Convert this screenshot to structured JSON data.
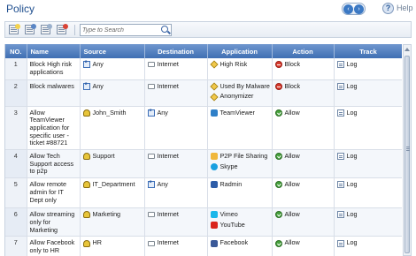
{
  "header": {
    "title": "Policy",
    "help_label": "Help"
  },
  "toolbar": {
    "icons": [
      "new-rule-icon",
      "edit-rule-icon",
      "copy-rule-icon",
      "delete-rule-icon"
    ],
    "search_placeholder": "Type to Search"
  },
  "table": {
    "columns": {
      "no": "NO.",
      "name": "Name",
      "source": "Source",
      "destination": "Destination",
      "application": "Application",
      "action": "Action",
      "track": "Track"
    },
    "rows": [
      {
        "no": "1",
        "name": "Block High risk applications",
        "source": {
          "label": "Any",
          "icon": "any-icon"
        },
        "destination": {
          "label": "Internet",
          "icon": "internet-icon"
        },
        "applications": [
          {
            "label": "High Risk",
            "icon": "tag-icon"
          }
        ],
        "action": {
          "label": "Block",
          "icon": "block-icon"
        },
        "track": "Log"
      },
      {
        "no": "2",
        "name": "Block malwares",
        "source": {
          "label": "Any",
          "icon": "any-icon"
        },
        "destination": {
          "label": "Internet",
          "icon": "internet-icon"
        },
        "applications": [
          {
            "label": "Used By Malware",
            "icon": "tag-icon"
          },
          {
            "label": "Anonymizer",
            "icon": "tag-icon"
          }
        ],
        "action": {
          "label": "Block",
          "icon": "block-icon"
        },
        "track": "Log"
      },
      {
        "no": "3",
        "name": "Allow TeamViewer application for specific user - ticket #88721",
        "source": {
          "label": "John_Smith",
          "icon": "user-icon"
        },
        "destination": {
          "label": "Any",
          "icon": "any-icon"
        },
        "applications": [
          {
            "label": "TeamViewer",
            "icon": "teamviewer-icon"
          }
        ],
        "action": {
          "label": "Allow",
          "icon": "allow-icon"
        },
        "track": "Log"
      },
      {
        "no": "4",
        "name": "Allow Tech Support access to p2p",
        "source": {
          "label": "Support",
          "icon": "group-icon"
        },
        "destination": {
          "label": "Internet",
          "icon": "internet-icon"
        },
        "applications": [
          {
            "label": "P2P File Sharing",
            "icon": "p2p-icon"
          },
          {
            "label": "Skype",
            "icon": "skype-icon"
          }
        ],
        "action": {
          "label": "Allow",
          "icon": "allow-icon"
        },
        "track": "Log"
      },
      {
        "no": "5",
        "name": "Allow remote admin for IT Dept only",
        "source": {
          "label": "IT_Department",
          "icon": "group-icon"
        },
        "destination": {
          "label": "Any",
          "icon": "any-icon"
        },
        "applications": [
          {
            "label": "Radmin",
            "icon": "radmin-icon"
          }
        ],
        "action": {
          "label": "Allow",
          "icon": "allow-icon"
        },
        "track": "Log"
      },
      {
        "no": "6",
        "name": "Allow streaming only for Marketing",
        "source": {
          "label": "Marketing",
          "icon": "group-icon"
        },
        "destination": {
          "label": "Internet",
          "icon": "internet-icon"
        },
        "applications": [
          {
            "label": "Vimeo",
            "icon": "vimeo-icon"
          },
          {
            "label": "YouTube",
            "icon": "youtube-icon"
          }
        ],
        "action": {
          "label": "Allow",
          "icon": "allow-icon"
        },
        "track": "Log"
      },
      {
        "no": "7",
        "name": "Allow Facebook only to HR",
        "source": {
          "label": "HR",
          "icon": "group-icon"
        },
        "destination": {
          "label": "Internet",
          "icon": "internet-icon"
        },
        "applications": [
          {
            "label": "Facebook",
            "icon": "facebook-icon"
          }
        ],
        "action": {
          "label": "Allow",
          "icon": "allow-icon"
        },
        "track": "Log"
      }
    ]
  },
  "colors": {
    "header_blue": "#4a78ba",
    "title_blue": "#1f4f8f",
    "block_red": "#d83b2e",
    "allow_green": "#46a23c"
  }
}
